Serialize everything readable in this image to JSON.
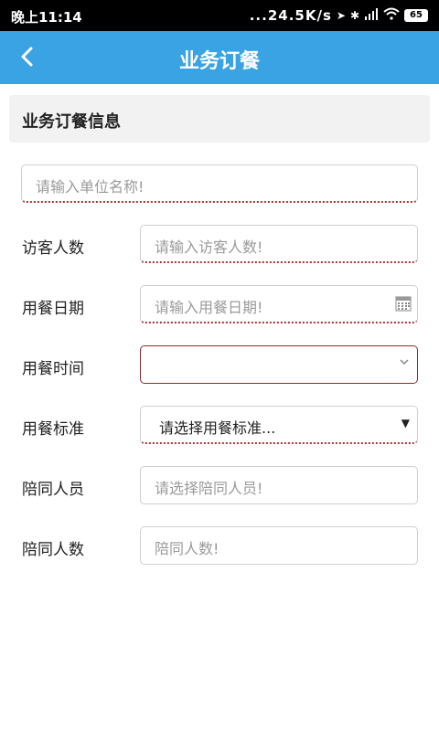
{
  "status": {
    "time": "晚上11:14",
    "net_speed": "...24.5K/s",
    "battery": "65"
  },
  "header": {
    "title": "业务订餐"
  },
  "section": {
    "title": "业务订餐信息"
  },
  "form": {
    "unit_name": {
      "placeholder": "请输入单位名称!"
    },
    "visitors": {
      "label": "访客人数",
      "placeholder": "请输入访客人数!"
    },
    "meal_date": {
      "label": "用餐日期",
      "placeholder": "请输入用餐日期!"
    },
    "meal_time": {
      "label": "用餐时间",
      "value": ""
    },
    "meal_standard": {
      "label": "用餐标准",
      "value": "请选择用餐标准..."
    },
    "companions": {
      "label": "陪同人员",
      "placeholder": "请选择陪同人员!"
    },
    "companion_count": {
      "label": "陪同人数",
      "placeholder": "陪同人数!"
    }
  },
  "colors": {
    "accent": "#3aa3e4",
    "error_border": "#8e2b2b"
  },
  "icons": {
    "back": "chevron-left-icon",
    "calendar": "calendar-icon",
    "dropdown": "chevron-down-icon"
  }
}
